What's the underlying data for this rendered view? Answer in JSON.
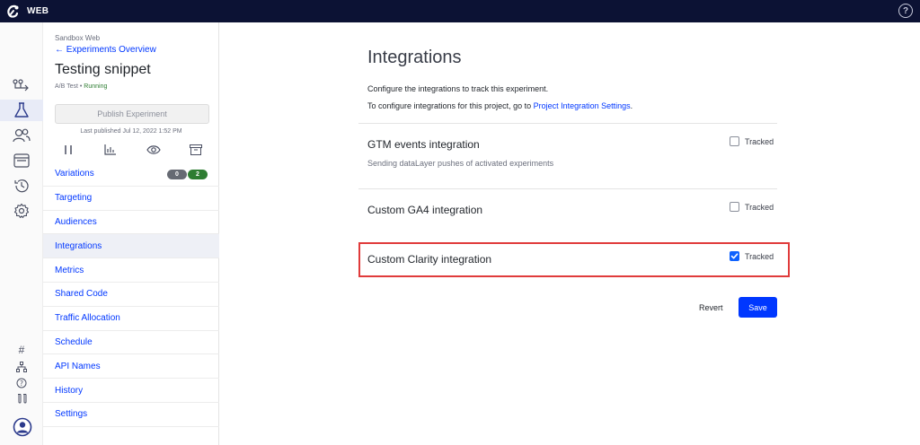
{
  "app": {
    "name": "WEB"
  },
  "experiment": {
    "project": "Sandbox Web",
    "back_link": "← Experiments Overview",
    "title": "Testing snippet",
    "type": "A/B Test",
    "separator": " • ",
    "status": "Running",
    "publish_label": "Publish Experiment",
    "last_published": "Last published Jul 12, 2022 1:52 PM"
  },
  "sidebar": {
    "items": [
      {
        "label": "Variations",
        "badges": [
          "0",
          "2"
        ]
      },
      {
        "label": "Targeting"
      },
      {
        "label": "Audiences"
      },
      {
        "label": "Integrations",
        "active": true
      },
      {
        "label": "Metrics"
      },
      {
        "label": "Shared Code"
      },
      {
        "label": "Traffic Allocation"
      },
      {
        "label": "Schedule"
      },
      {
        "label": "API Names"
      },
      {
        "label": "History"
      },
      {
        "label": "Settings"
      }
    ]
  },
  "main": {
    "title": "Integrations",
    "description": "Configure the integrations to track this experiment.",
    "config_text": "To configure integrations for this project, go to ",
    "config_link": "Project Integration Settings",
    "config_end": ".",
    "integrations": [
      {
        "name": "GTM events integration",
        "subtitle": "Sending dataLayer pushes of activated experiments",
        "tracked_label": "Tracked",
        "checked": false
      },
      {
        "name": "Custom GA4 integration",
        "tracked_label": "Tracked",
        "checked": false
      },
      {
        "name": "Custom Clarity integration",
        "tracked_label": "Tracked",
        "checked": true
      }
    ],
    "revert_label": "Revert",
    "save_label": "Save"
  },
  "colors": {
    "topbar": "#0c1234",
    "accent": "#0037ff",
    "highlight": "#e03b3b",
    "running": "#2e7d32"
  }
}
